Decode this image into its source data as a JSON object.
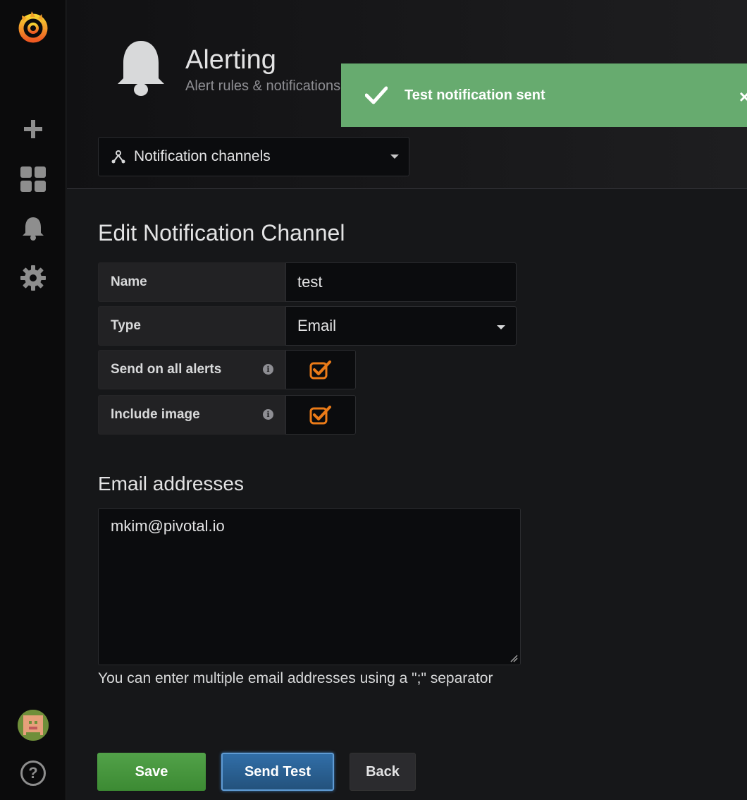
{
  "sidebar": {
    "items": [
      {
        "name": "create",
        "icon": "plus-icon"
      },
      {
        "name": "dashboards",
        "icon": "dashboard-grid-icon"
      },
      {
        "name": "alerting",
        "icon": "bell-icon"
      },
      {
        "name": "configuration",
        "icon": "gear-icon"
      }
    ],
    "help_glyph": "?"
  },
  "header": {
    "title": "Alerting",
    "subtitle": "Alert rules & notifications",
    "icon": "bell-icon",
    "nav_select": {
      "label": "Notification channels",
      "icon": "webhook-icon"
    }
  },
  "toast": {
    "message": "Test notification sent",
    "color": "#67ab6f",
    "close_glyph": "×"
  },
  "form": {
    "title": "Edit Notification Channel",
    "name_label": "Name",
    "name_value": "test",
    "type_label": "Type",
    "type_value": "Email",
    "send_all_label": "Send on all alerts",
    "send_all_checked": true,
    "include_image_label": "Include image",
    "include_image_checked": true,
    "info_glyph": "i"
  },
  "email": {
    "title": "Email addresses",
    "value": "mkim@pivotal.io",
    "hint": "You can enter multiple email addresses using a \";\" separator"
  },
  "buttons": {
    "save": "Save",
    "send_test": "Send Test",
    "back": "Back"
  },
  "colors": {
    "accent_orange": "#eb7b18",
    "primary_green": "#3c8a33",
    "primary_blue": "#23527c"
  }
}
